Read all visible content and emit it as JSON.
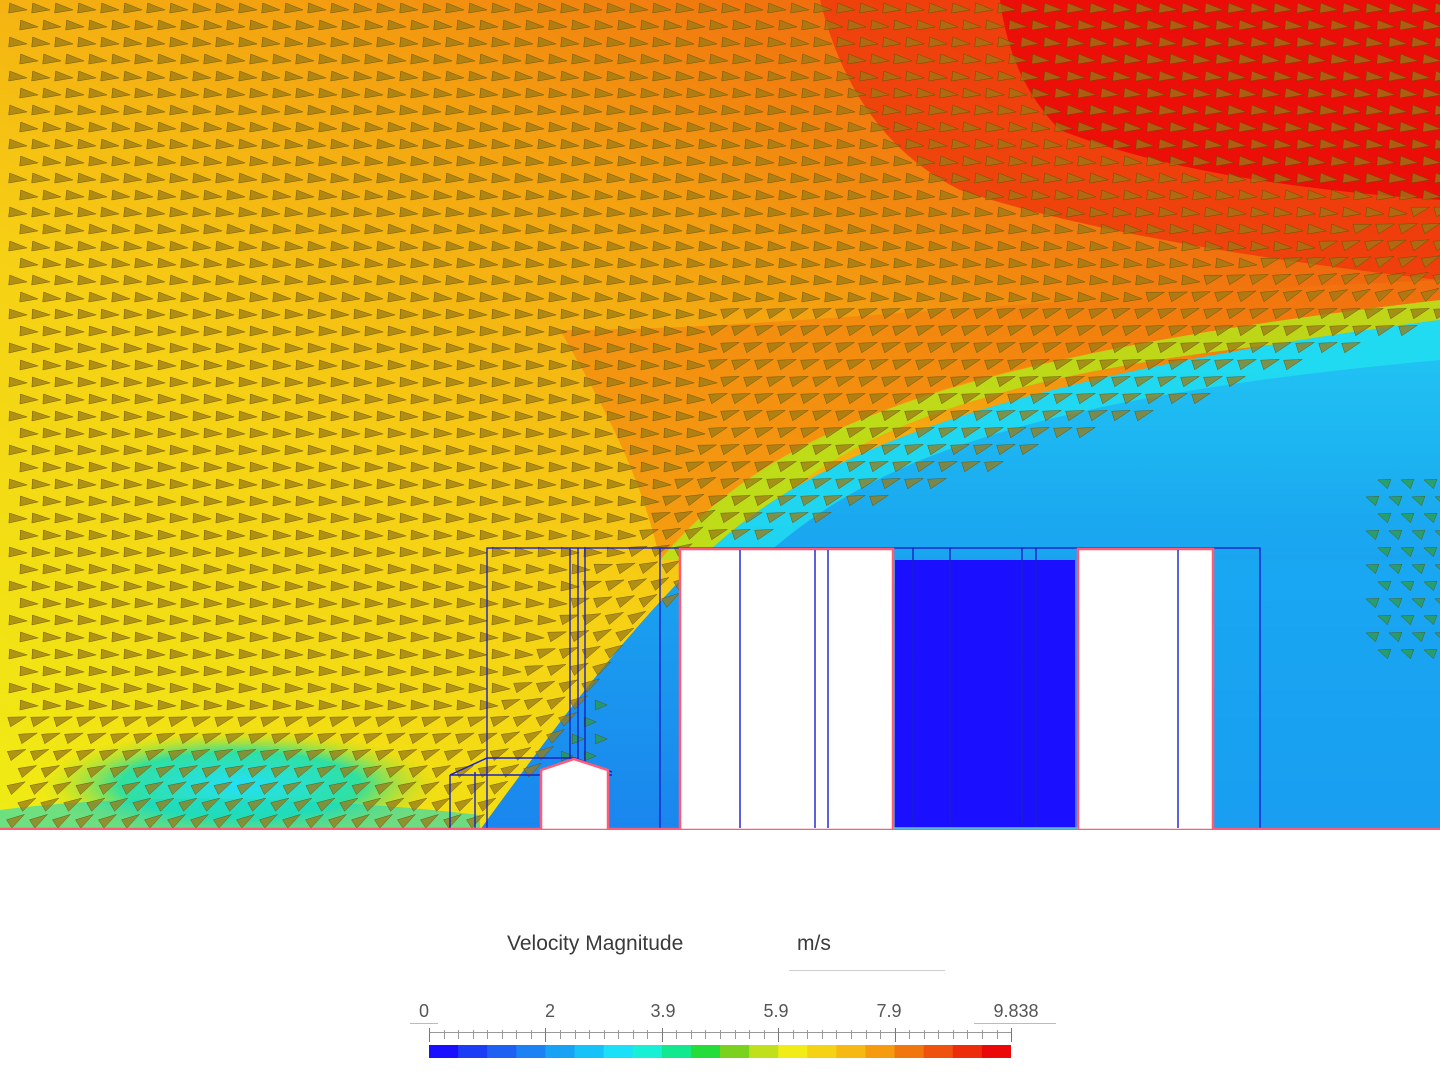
{
  "legend": {
    "title": "Velocity Magnitude",
    "unit": "m/s",
    "ticks": [
      "0",
      "2",
      "3.9",
      "5.9",
      "7.9",
      "9.838"
    ],
    "min": 0,
    "max": 9.838
  },
  "colors": {
    "scale": [
      "#1a10ff",
      "#1c3df6",
      "#1e60f2",
      "#1c82f3",
      "#18a2f5",
      "#16c2f7",
      "#1ce0f8",
      "#18f0d6",
      "#12e88e",
      "#24dc3a",
      "#7ad21e",
      "#bfe01a",
      "#f2ec16",
      "#f6d214",
      "#f6b812",
      "#f69a10",
      "#f2760e",
      "#ee520c",
      "#ec2c0a",
      "#ea0808"
    ],
    "wall_outline": "#ff5a78",
    "mesh_lines": "#1820c8",
    "building_fill": "#ffffff"
  }
}
